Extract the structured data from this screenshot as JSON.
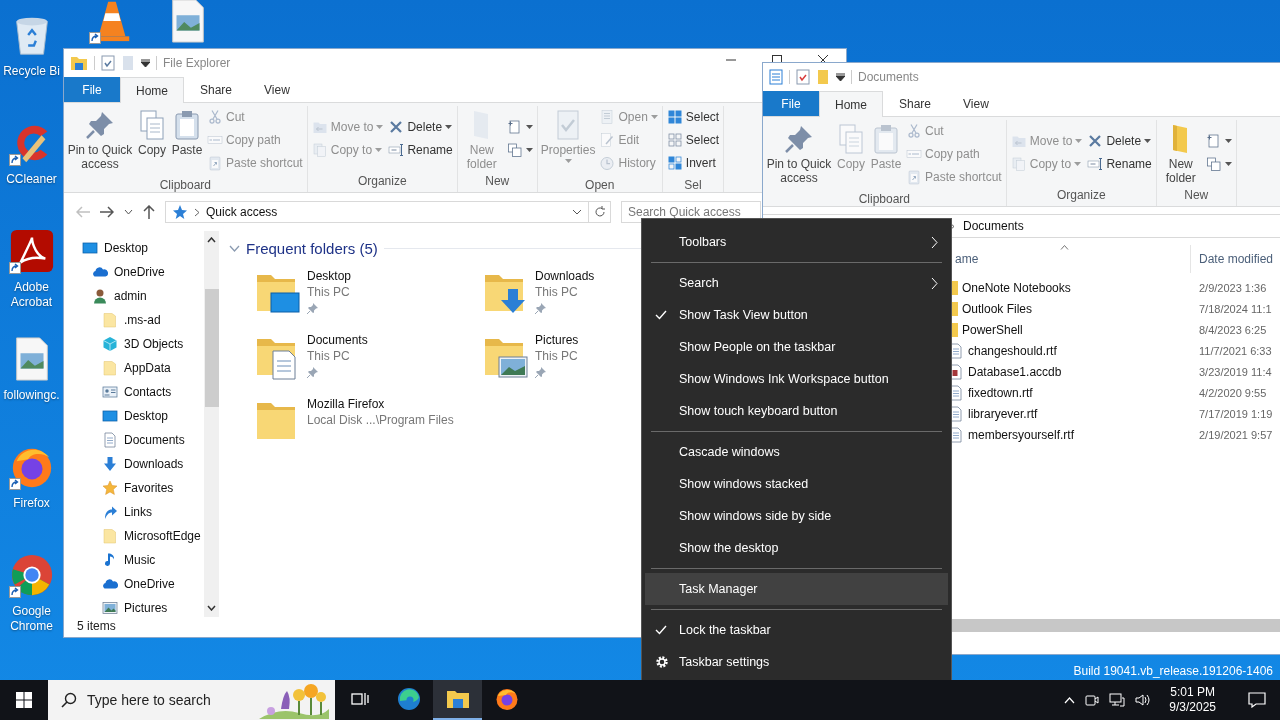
{
  "desktop": {
    "icons": [
      {
        "kind": "recycle-bin",
        "label": "Recycle Bi",
        "shortcut": false
      },
      {
        "kind": "ccleaner",
        "label": "CCleaner",
        "shortcut": true
      },
      {
        "kind": "acrobat",
        "label": "Adobe Acrobat",
        "shortcut": true
      },
      {
        "kind": "image-file",
        "label": "followingc.",
        "shortcut": false
      },
      {
        "kind": "firefox",
        "label": "Firefox",
        "shortcut": true
      },
      {
        "kind": "chrome",
        "label": "Google Chrome",
        "shortcut": true
      }
    ],
    "top_icons": [
      {
        "kind": "vlc",
        "shortcut": true
      },
      {
        "kind": "image-file",
        "shortcut": false
      }
    ],
    "build_text": "Build 19041.vb_release.191206-1406"
  },
  "explorer": {
    "title": "File Explorer",
    "tabs": [
      {
        "label": "File",
        "kind": "file",
        "selected": false
      },
      {
        "label": "Home",
        "kind": "tab",
        "selected": true
      },
      {
        "label": "Share",
        "kind": "tab",
        "selected": false
      },
      {
        "label": "View",
        "kind": "tab",
        "selected": false
      }
    ],
    "ribbon": [
      {
        "label": "Clipboard",
        "columns": [
          {
            "buttons": [
              {
                "kind": "pin",
                "label": "Pin to Quick access",
                "disabled": false,
                "dropdown": false
              }
            ]
          },
          {
            "buttons": [
              {
                "kind": "copy",
                "label": "Copy",
                "disabled": false,
                "dropdown": false
              }
            ]
          },
          {
            "buttons": [
              {
                "kind": "paste",
                "label": "Paste",
                "disabled": false,
                "dropdown": false
              }
            ]
          },
          {
            "buttons": [
              {
                "kind": "cut",
                "label": "Cut",
                "disabled": true,
                "dropdown": false
              },
              {
                "kind": "copy-path",
                "label": "Copy path",
                "disabled": true,
                "dropdown": false
              },
              {
                "kind": "paste-shortcut",
                "label": "Paste shortcut",
                "disabled": true,
                "dropdown": false
              }
            ]
          }
        ]
      },
      {
        "label": "Organize",
        "columns": [
          {
            "buttons": [
              {
                "kind": "move-to",
                "label": "Move to",
                "disabled": true,
                "dropdown": true
              },
              {
                "kind": "copy-to",
                "label": "Copy to",
                "disabled": true,
                "dropdown": true
              }
            ]
          },
          {
            "buttons": [
              {
                "kind": "delete",
                "label": "Delete",
                "disabled": false,
                "dropdown": true
              },
              {
                "kind": "rename",
                "label": "Rename",
                "disabled": false,
                "dropdown": false
              }
            ]
          }
        ]
      },
      {
        "label": "New",
        "columns": [
          {
            "buttons": [
              {
                "kind": "new-folder",
                "label": "New folder",
                "disabled": true,
                "dropdown": false
              }
            ]
          },
          {
            "buttons": [
              {
                "kind": "new-item",
                "disabled": false,
                "dropdown": true
              },
              {
                "kind": "easy-access",
                "disabled": false,
                "dropdown": true
              }
            ]
          }
        ]
      },
      {
        "label": "Open",
        "columns": [
          {
            "buttons": [
              {
                "kind": "properties",
                "label": "Properties",
                "disabled": true,
                "dropdown": true
              }
            ]
          },
          {
            "buttons": [
              {
                "kind": "open",
                "label": "Open",
                "disabled": true,
                "dropdown": true
              },
              {
                "kind": "edit",
                "label": "Edit",
                "disabled": true,
                "dropdown": false
              },
              {
                "kind": "history",
                "label": "History",
                "disabled": true,
                "dropdown": false
              }
            ]
          }
        ]
      },
      {
        "label": "Sel",
        "columns": [
          {
            "buttons": [
              {
                "kind": "select-all",
                "label": "Select",
                "disabled": false,
                "dropdown": false
              },
              {
                "kind": "select-none",
                "label": "Select",
                "disabled": false,
                "dropdown": false
              },
              {
                "kind": "invert",
                "label": "Invert",
                "disabled": false,
                "dropdown": false
              }
            ]
          }
        ]
      }
    ],
    "path": "Quick access",
    "search_placeholder": "Search Quick access",
    "nav": [
      {
        "kind": "desktop",
        "label": "Desktop",
        "children": [
          {
            "kind": "onedrive",
            "label": "OneDrive"
          },
          {
            "kind": "user",
            "label": "admin",
            "children": [
              {
                "kind": "folder",
                "label": ".ms-ad"
              },
              {
                "kind": "cube",
                "label": "3D Objects"
              },
              {
                "kind": "folder",
                "label": "AppData"
              },
              {
                "kind": "contacts",
                "label": "Contacts"
              },
              {
                "kind": "desktop",
                "label": "Desktop"
              },
              {
                "kind": "documents",
                "label": "Documents"
              },
              {
                "kind": "downloads",
                "label": "Downloads"
              },
              {
                "kind": "star",
                "label": "Favorites"
              },
              {
                "kind": "links",
                "label": "Links"
              },
              {
                "kind": "folder",
                "label": "MicrosoftEdge"
              },
              {
                "kind": "music",
                "label": "Music"
              },
              {
                "kind": "onedrive",
                "label": "OneDrive"
              },
              {
                "kind": "pictures",
                "label": "Pictures"
              }
            ]
          }
        ]
      }
    ],
    "section": {
      "label": "Frequent folders (5)",
      "expanded": true
    },
    "tiles": [
      {
        "kind": "desktop",
        "name": "Desktop",
        "location": "This PC",
        "pinned": true
      },
      {
        "kind": "downloads",
        "name": "Downloads",
        "location": "This PC",
        "pinned": true
      },
      {
        "kind": "documents",
        "name": "Documents",
        "location": "This PC",
        "pinned": true
      },
      {
        "kind": "pictures",
        "name": "Pictures",
        "location": "This PC",
        "pinned": true
      },
      {
        "kind": "plain",
        "name": "Mozilla Firefox",
        "location": "Local Disk ...\\Program Files",
        "pinned": false
      }
    ],
    "status": "5 items"
  },
  "documents_window": {
    "title": "Documents",
    "tabs": [
      {
        "label": "File",
        "kind": "file",
        "selected": false
      },
      {
        "label": "Home",
        "kind": "tab",
        "selected": true
      },
      {
        "label": "Share",
        "kind": "tab",
        "selected": false
      },
      {
        "label": "View",
        "kind": "tab",
        "selected": false
      }
    ],
    "ribbon": [
      {
        "label": "Clipboard",
        "columns": [
          {
            "buttons": [
              {
                "kind": "pin",
                "label": "Pin to Quick access",
                "disabled": false,
                "dropdown": false
              }
            ]
          },
          {
            "buttons": [
              {
                "kind": "copy",
                "label": "Copy",
                "disabled": true,
                "dropdown": false
              }
            ]
          },
          {
            "buttons": [
              {
                "kind": "paste",
                "label": "Paste",
                "disabled": true,
                "dropdown": false
              }
            ]
          },
          {
            "buttons": [
              {
                "kind": "cut",
                "label": "Cut",
                "disabled": true,
                "dropdown": false
              },
              {
                "kind": "copy-path",
                "label": "Copy path",
                "disabled": true,
                "dropdown": false
              },
              {
                "kind": "paste-shortcut",
                "label": "Paste shortcut",
                "disabled": true,
                "dropdown": false
              }
            ]
          }
        ]
      },
      {
        "label": "Organize",
        "columns": [
          {
            "buttons": [
              {
                "kind": "move-to",
                "label": "Move to",
                "disabled": true,
                "dropdown": true
              },
              {
                "kind": "copy-to",
                "label": "Copy to",
                "disabled": true,
                "dropdown": true
              }
            ]
          },
          {
            "buttons": [
              {
                "kind": "delete",
                "label": "Delete",
                "disabled": false,
                "dropdown": true
              },
              {
                "kind": "rename",
                "label": "Rename",
                "disabled": false,
                "dropdown": false
              }
            ]
          }
        ]
      },
      {
        "label": "New",
        "columns": [
          {
            "buttons": [
              {
                "kind": "new-folder-yellow",
                "label": "New folder",
                "disabled": false,
                "dropdown": false
              }
            ]
          },
          {
            "buttons": [
              {
                "kind": "new-item",
                "disabled": false,
                "dropdown": true
              },
              {
                "kind": "easy-access",
                "disabled": false,
                "dropdown": true
              }
            ]
          }
        ]
      }
    ],
    "path": "Documents",
    "columns": [
      {
        "label": "ame",
        "sorted": true
      },
      {
        "label": "Date modified",
        "sorted": false
      }
    ],
    "rows": [
      {
        "kind": "folder",
        "name": "OneNote Notebooks",
        "date": "2/9/2023 1:36"
      },
      {
        "kind": "folder",
        "name": "Outlook Files",
        "date": "7/18/2024 11:1"
      },
      {
        "kind": "folder",
        "name": "PowerShell",
        "date": "8/4/2023 6:25"
      },
      {
        "kind": "file",
        "name": "changeshould.rtf",
        "date": "11/7/2021 6:33"
      },
      {
        "kind": "database",
        "name": "Database1.accdb",
        "date": "3/23/2019 11:4"
      },
      {
        "kind": "file",
        "name": "fixedtown.rtf",
        "date": "4/2/2020 9:55"
      },
      {
        "kind": "file",
        "name": "libraryever.rtf",
        "date": "7/17/2019 1:19"
      },
      {
        "kind": "file",
        "name": "membersyourself.rtf",
        "date": "2/19/2021 9:57"
      }
    ]
  },
  "context_menu": {
    "items": [
      {
        "kind": "item",
        "label": "Toolbars",
        "checked": false,
        "submenu": true,
        "selected": false
      },
      {
        "kind": "separator"
      },
      {
        "kind": "item",
        "label": "Search",
        "checked": false,
        "submenu": true,
        "selected": false
      },
      {
        "kind": "item",
        "label": "Show Task View button",
        "checked": true,
        "submenu": false,
        "selected": false
      },
      {
        "kind": "item",
        "label": "Show People on the taskbar",
        "checked": false,
        "submenu": false,
        "selected": false
      },
      {
        "kind": "item",
        "label": "Show Windows Ink Workspace button",
        "checked": false,
        "submenu": false,
        "selected": false
      },
      {
        "kind": "item",
        "label": "Show touch keyboard button",
        "checked": false,
        "submenu": false,
        "selected": false
      },
      {
        "kind": "separator"
      },
      {
        "kind": "item",
        "label": "Cascade windows",
        "checked": false,
        "submenu": false,
        "selected": false
      },
      {
        "kind": "item",
        "label": "Show windows stacked",
        "checked": false,
        "submenu": false,
        "selected": false
      },
      {
        "kind": "item",
        "label": "Show windows side by side",
        "checked": false,
        "submenu": false,
        "selected": false
      },
      {
        "kind": "item",
        "label": "Show the desktop",
        "checked": false,
        "submenu": false,
        "selected": false
      },
      {
        "kind": "separator"
      },
      {
        "kind": "item",
        "label": "Task Manager",
        "checked": false,
        "submenu": false,
        "selected": true
      },
      {
        "kind": "separator"
      },
      {
        "kind": "item",
        "label": "Lock the taskbar",
        "checked": true,
        "submenu": false,
        "selected": false
      },
      {
        "kind": "settings",
        "label": "Taskbar settings",
        "checked": false,
        "submenu": false,
        "selected": false
      }
    ]
  },
  "taskbar": {
    "search_label": "Type here to search",
    "apps": [
      {
        "kind": "task-view",
        "active": false
      },
      {
        "kind": "edge",
        "active": false
      },
      {
        "kind": "explorer",
        "active": true
      },
      {
        "kind": "firefox",
        "active": false
      }
    ],
    "time": "5:01 PM",
    "date": "9/3/2025"
  }
}
